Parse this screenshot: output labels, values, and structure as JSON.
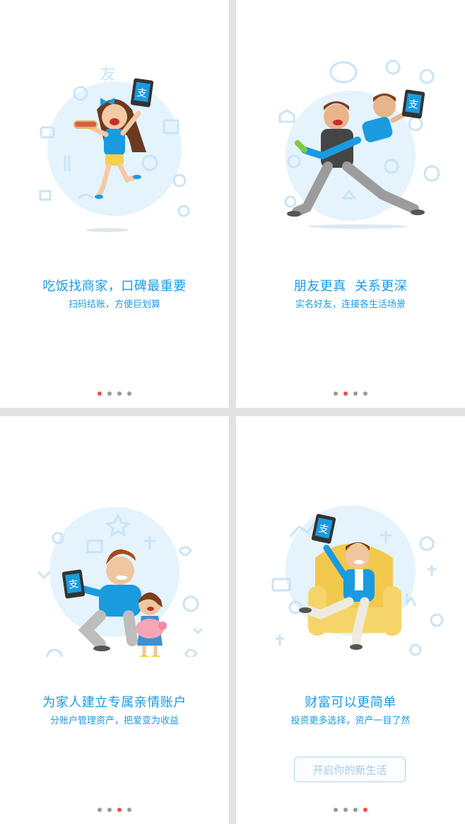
{
  "screens": [
    {
      "title": "吃饭找商家，口碑最重要",
      "subtitle": "扫码结账，方便巨划算",
      "page_indicator": {
        "active": 1,
        "total": 4
      },
      "illustration": "girl-with-hotdog-and-phone"
    },
    {
      "title": "朋友更真  关系更深",
      "subtitle": "实名好友，连接各生活场景",
      "page_indicator": {
        "active": 2,
        "total": 4
      },
      "illustration": "friends-carrying-with-phone"
    },
    {
      "title": "为家人建立专属亲情账户",
      "subtitle": "分账户管理资产，把爱变为收益",
      "page_indicator": {
        "active": 3,
        "total": 4
      },
      "illustration": "father-daughter-piggy-bank"
    },
    {
      "title": "财富可以更简单",
      "subtitle": "投资更多选择，资产一目了然",
      "page_indicator": {
        "active": 4,
        "total": 4
      },
      "illustration": "man-in-armchair-with-phone",
      "start_button": "开启你的新生活"
    }
  ],
  "app_logo_glyph": "支",
  "colors": {
    "accent": "#1a9be0",
    "active_dot": "#f24b4b",
    "inactive_dot": "#9a9a9a",
    "circle_bg": "#e4f3fc",
    "background_icons": "#c9e4f6",
    "panel_divider": "#e2e2e2"
  }
}
